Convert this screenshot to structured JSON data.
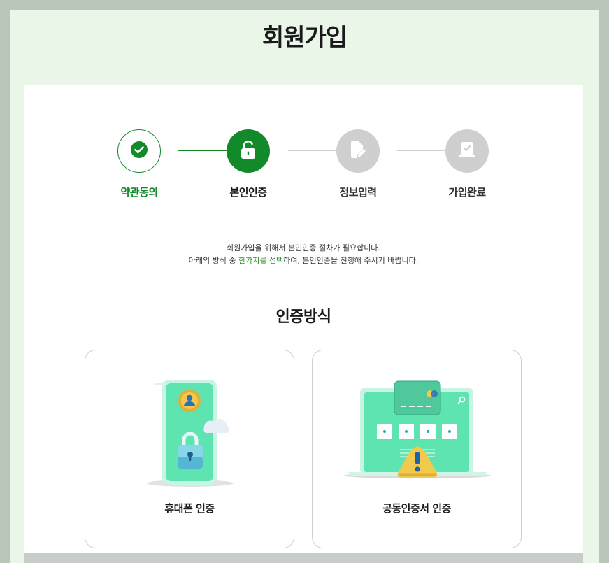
{
  "header": {
    "title": "회원가입"
  },
  "steps": [
    {
      "label": "약관동의",
      "state": "done",
      "icon": "check-icon"
    },
    {
      "label": "본인인증",
      "state": "current",
      "icon": "unlock-icon"
    },
    {
      "label": "정보입력",
      "state": "pending",
      "icon": "edit-icon"
    },
    {
      "label": "가입완료",
      "state": "pending",
      "icon": "clipboard-check-icon"
    }
  ],
  "description": {
    "line1": "회원가입을 위해서 본인인증 절차가 필요합니다.",
    "line2_pre": "아래의 방식 중 ",
    "line2_highlight": "한가지를 선택",
    "line2_post": "하여, 본인인증을 진행해 주시기 바랍니다."
  },
  "method_section": {
    "title": "인증방식",
    "methods": [
      {
        "label": "휴대폰 인증",
        "icon": "phone-lock-icon"
      },
      {
        "label": "공동인증서 인증",
        "icon": "certificate-warning-icon"
      }
    ]
  },
  "colors": {
    "primary": "#138a2a",
    "pending": "#cfcfcf",
    "background": "#e9f6e8",
    "highlight": "#2c8f2c"
  }
}
